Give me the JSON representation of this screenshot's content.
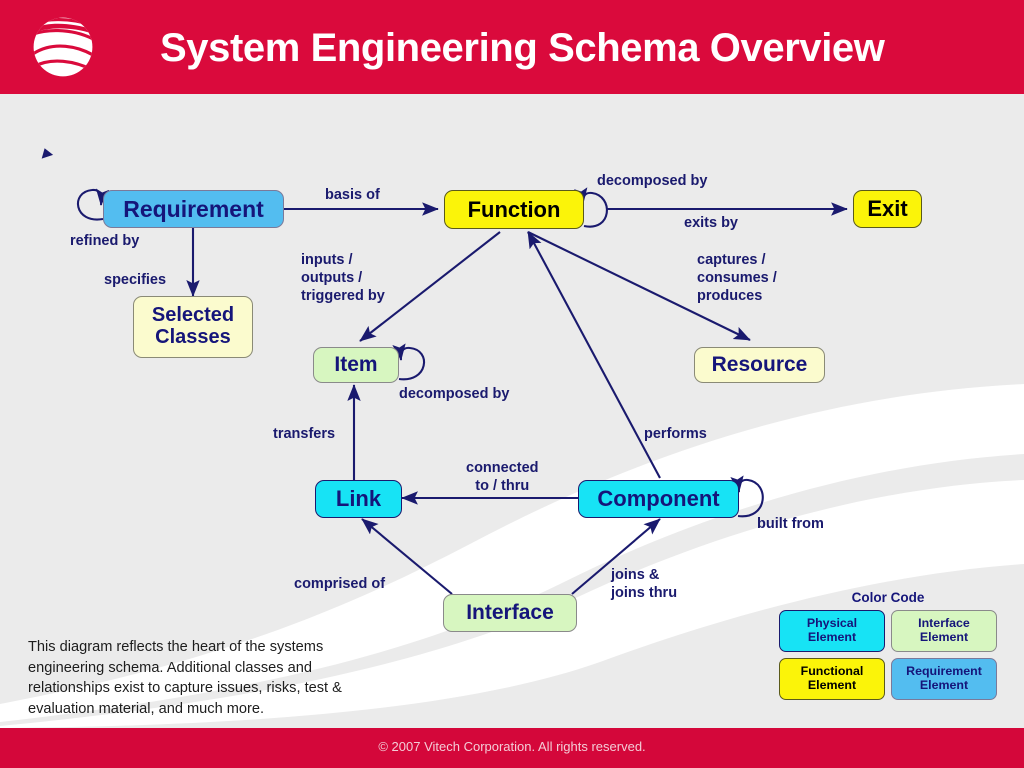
{
  "header": {
    "title": "System Engineering Schema Overview",
    "logo_icon": "globe-sphere-logo",
    "background_color": "#DA0A3C"
  },
  "footer": {
    "copyright": "© 2007 Vitech Corporation. All rights reserved.",
    "background_color": "#D4073A"
  },
  "diagram": {
    "bullet_marker_icon": "triangle-bullet-icon",
    "nodes": [
      {
        "id": "requirement",
        "label": "Requirement",
        "color_class": "Requirement Element"
      },
      {
        "id": "selected-classes",
        "label": "Selected\nClasses",
        "color_class": "Selected Classes"
      },
      {
        "id": "function",
        "label": "Function",
        "color_class": "Functional Element"
      },
      {
        "id": "exit",
        "label": "Exit",
        "color_class": "Functional Element"
      },
      {
        "id": "item",
        "label": "Item",
        "color_class": "Interface Element"
      },
      {
        "id": "resource",
        "label": "Resource",
        "color_class": "Resource"
      },
      {
        "id": "link",
        "label": "Link",
        "color_class": "Physical Element"
      },
      {
        "id": "component",
        "label": "Component",
        "color_class": "Physical Element"
      },
      {
        "id": "interface",
        "label": "Interface",
        "color_class": "Interface Element"
      }
    ],
    "edges": [
      {
        "id": "refined-by",
        "label": "refined by",
        "from": "requirement",
        "to": "requirement"
      },
      {
        "id": "basis-of",
        "label": "basis of",
        "from": "requirement",
        "to": "function"
      },
      {
        "id": "specifies",
        "label": "specifies",
        "from": "requirement",
        "to": "selected-classes"
      },
      {
        "id": "decomposed-by-fn",
        "label": "decomposed by",
        "from": "function",
        "to": "function"
      },
      {
        "id": "exits-by",
        "label": "exits by",
        "from": "function",
        "to": "exit"
      },
      {
        "id": "inputs-outputs",
        "label": "inputs /\noutputs /\ntriggered by",
        "from": "function",
        "to": "item"
      },
      {
        "id": "captures-consumes",
        "label": "captures /\nconsumes /\nproduces",
        "from": "function",
        "to": "resource"
      },
      {
        "id": "decomposed-by-item",
        "label": "decomposed by",
        "from": "item",
        "to": "item"
      },
      {
        "id": "transfers",
        "label": "transfers",
        "from": "link",
        "to": "item"
      },
      {
        "id": "connected-to-thru",
        "label": "connected\nto / thru",
        "from": "component",
        "to": "link"
      },
      {
        "id": "performs",
        "label": "performs",
        "from": "component",
        "to": "function"
      },
      {
        "id": "built-from",
        "label": "built from",
        "from": "component",
        "to": "component"
      },
      {
        "id": "comprised-of",
        "label": "comprised of",
        "from": "interface",
        "to": "link"
      },
      {
        "id": "joins-thru",
        "label": "joins &\njoins thru",
        "from": "interface",
        "to": "component"
      }
    ]
  },
  "caption": {
    "text": "This diagram reflects the heart of the systems engineering schema. Additional classes and relationships exist to capture issues, risks, test & evaluation material, and much more."
  },
  "legend": {
    "title": "Color Code",
    "items": [
      {
        "label": "Physical\nElement",
        "color": "#17E3F5"
      },
      {
        "label": "Interface\nElement",
        "color": "#D7F6C0"
      },
      {
        "label": "Functional\nElement",
        "color": "#FBF409"
      },
      {
        "label": "Requirement\nElement",
        "color": "#53BDF0"
      }
    ]
  }
}
